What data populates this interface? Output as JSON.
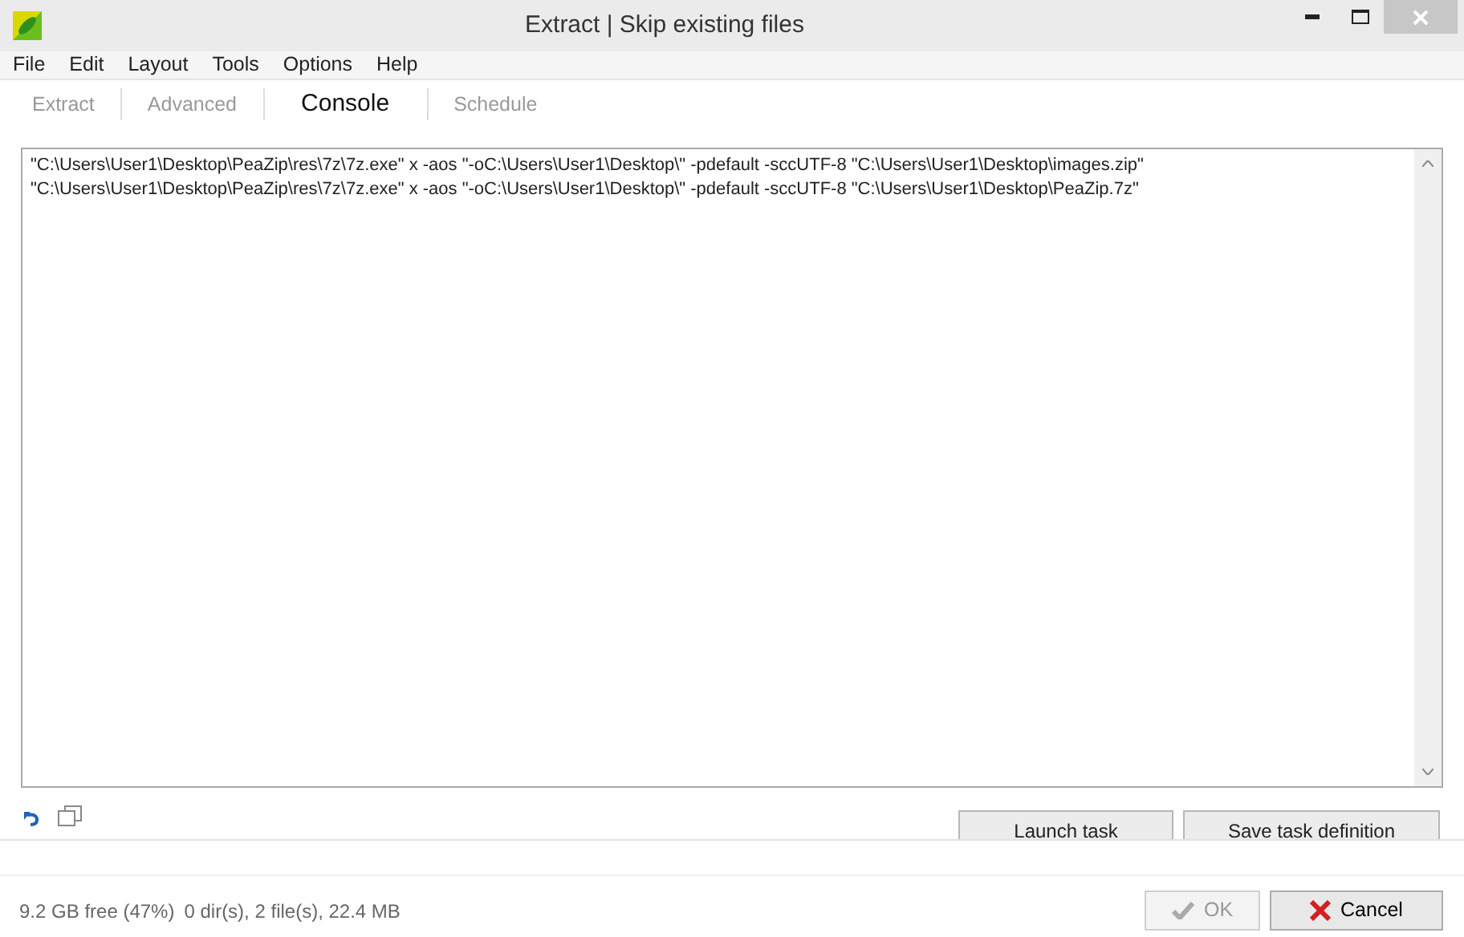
{
  "window": {
    "title": "Extract | Skip existing files"
  },
  "menu": [
    "File",
    "Edit",
    "Layout",
    "Tools",
    "Options",
    "Help"
  ],
  "tabs": [
    {
      "label": "Extract",
      "selected": false
    },
    {
      "label": "Advanced",
      "selected": false
    },
    {
      "label": "Console",
      "selected": true
    },
    {
      "label": "Schedule",
      "selected": false
    }
  ],
  "console_lines": [
    "\"C:\\Users\\User1\\Desktop\\PeaZip\\res\\7z\\7z.exe\" x -aos \"-oC:\\Users\\User1\\Desktop\\\" -pdefault -sccUTF-8 \"C:\\Users\\User1\\Desktop\\images.zip\"",
    "\"C:\\Users\\User1\\Desktop\\PeaZip\\res\\7z\\7z.exe\" x -aos \"-oC:\\Users\\User1\\Desktop\\\" -pdefault -sccUTF-8 \"C:\\Users\\User1\\Desktop\\PeaZip.7z\""
  ],
  "task_buttons": [
    "Launch task",
    "Save task definition"
  ],
  "status_bar": {
    "free_space": "9.2 GB free (47%)",
    "summary": "0 dir(s), 2 file(s), 22.4 MB"
  },
  "dialog_buttons": [
    {
      "label": "OK",
      "kind": "ok",
      "disabled": true
    },
    {
      "label": "Cancel",
      "kind": "cancel",
      "disabled": false
    }
  ]
}
